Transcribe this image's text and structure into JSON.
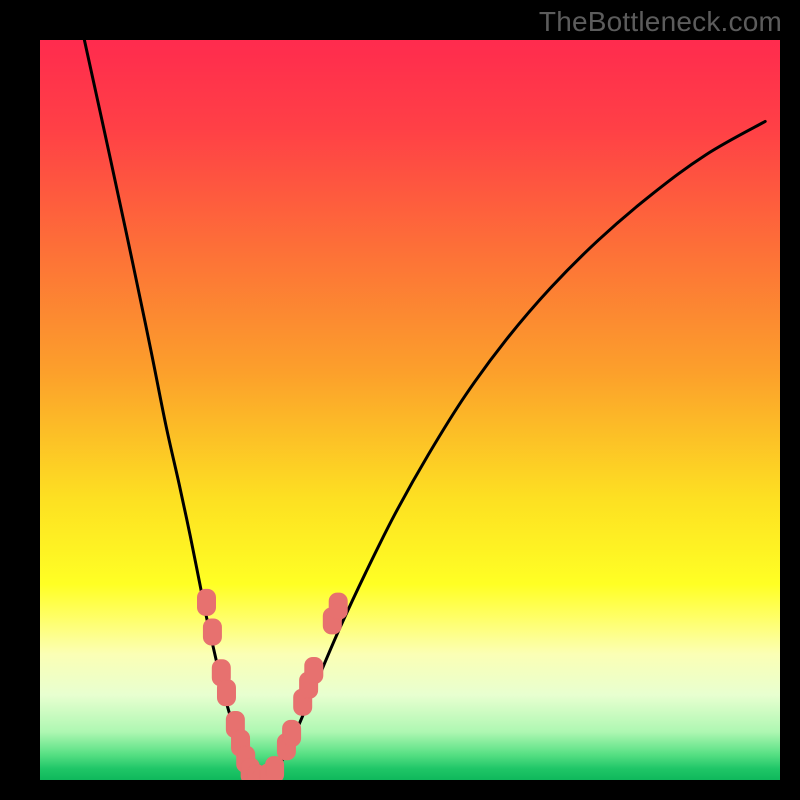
{
  "watermark": "TheBottleneck.com",
  "colors": {
    "frame": "#000000",
    "curve": "#000000",
    "marker_fill": "#e7716f",
    "marker_stroke": "#e7716f",
    "gradient_stops": [
      {
        "offset": 0.0,
        "color": "#ff2b4e"
      },
      {
        "offset": 0.12,
        "color": "#ff4046"
      },
      {
        "offset": 0.28,
        "color": "#fd6f38"
      },
      {
        "offset": 0.45,
        "color": "#fca02b"
      },
      {
        "offset": 0.62,
        "color": "#fde022"
      },
      {
        "offset": 0.735,
        "color": "#ffff24"
      },
      {
        "offset": 0.78,
        "color": "#ffff66"
      },
      {
        "offset": 0.83,
        "color": "#fbffb5"
      },
      {
        "offset": 0.885,
        "color": "#e8ffd0"
      },
      {
        "offset": 0.935,
        "color": "#aef7b2"
      },
      {
        "offset": 0.965,
        "color": "#58e084"
      },
      {
        "offset": 0.985,
        "color": "#1fc667"
      },
      {
        "offset": 1.0,
        "color": "#0fb85c"
      }
    ]
  },
  "chart_data": {
    "type": "line",
    "title": "",
    "xlabel": "",
    "ylabel": "",
    "xlim": [
      0,
      100
    ],
    "ylim": [
      0,
      100
    ],
    "note": "Bottleneck-style V-curve: y represents mismatch percentage (0 at optimum). Values are read from pixel positions; axes are unlabeled in the source image so units are normalized 0–100.",
    "series": [
      {
        "name": "left-branch",
        "x": [
          6.0,
          9.5,
          12.5,
          15.0,
          17.0,
          18.8,
          20.3,
          21.5,
          22.5,
          23.4,
          24.2,
          24.9,
          25.6,
          26.2,
          26.8,
          27.3,
          27.9,
          28.4
        ],
        "y": [
          100.0,
          84.0,
          70.0,
          58.0,
          48.0,
          40.0,
          33.0,
          27.0,
          22.0,
          18.0,
          14.5,
          11.5,
          9.0,
          6.8,
          5.0,
          3.4,
          2.0,
          0.9
        ]
      },
      {
        "name": "valley",
        "x": [
          28.4,
          29.2,
          30.0,
          30.8,
          31.6
        ],
        "y": [
          0.9,
          0.2,
          0.0,
          0.2,
          0.9
        ]
      },
      {
        "name": "right-branch",
        "x": [
          31.6,
          33.0,
          35.0,
          37.5,
          40.5,
          44.0,
          48.0,
          52.5,
          57.5,
          63.0,
          69.0,
          75.5,
          82.5,
          90.0,
          98.0
        ],
        "y": [
          0.9,
          3.2,
          7.5,
          13.5,
          20.5,
          28.0,
          36.0,
          44.0,
          52.0,
          59.5,
          66.5,
          73.0,
          79.0,
          84.5,
          89.0
        ]
      }
    ],
    "markers": {
      "name": "highlighted-points",
      "style": "rounded-rect",
      "fill": "#e7716f",
      "points": [
        {
          "x": 22.5,
          "y": 24.0
        },
        {
          "x": 23.3,
          "y": 20.0
        },
        {
          "x": 24.5,
          "y": 14.5
        },
        {
          "x": 25.2,
          "y": 11.8
        },
        {
          "x": 26.4,
          "y": 7.5
        },
        {
          "x": 27.1,
          "y": 5.0
        },
        {
          "x": 27.8,
          "y": 2.8
        },
        {
          "x": 28.4,
          "y": 1.2
        },
        {
          "x": 29.2,
          "y": 0.3
        },
        {
          "x": 30.0,
          "y": 0.0
        },
        {
          "x": 30.9,
          "y": 0.4
        },
        {
          "x": 31.7,
          "y": 1.4
        },
        {
          "x": 33.3,
          "y": 4.5
        },
        {
          "x": 34.0,
          "y": 6.3
        },
        {
          "x": 35.5,
          "y": 10.5
        },
        {
          "x": 36.3,
          "y": 12.8
        },
        {
          "x": 37.0,
          "y": 14.8
        },
        {
          "x": 39.5,
          "y": 21.5
        },
        {
          "x": 40.3,
          "y": 23.5
        }
      ]
    }
  }
}
